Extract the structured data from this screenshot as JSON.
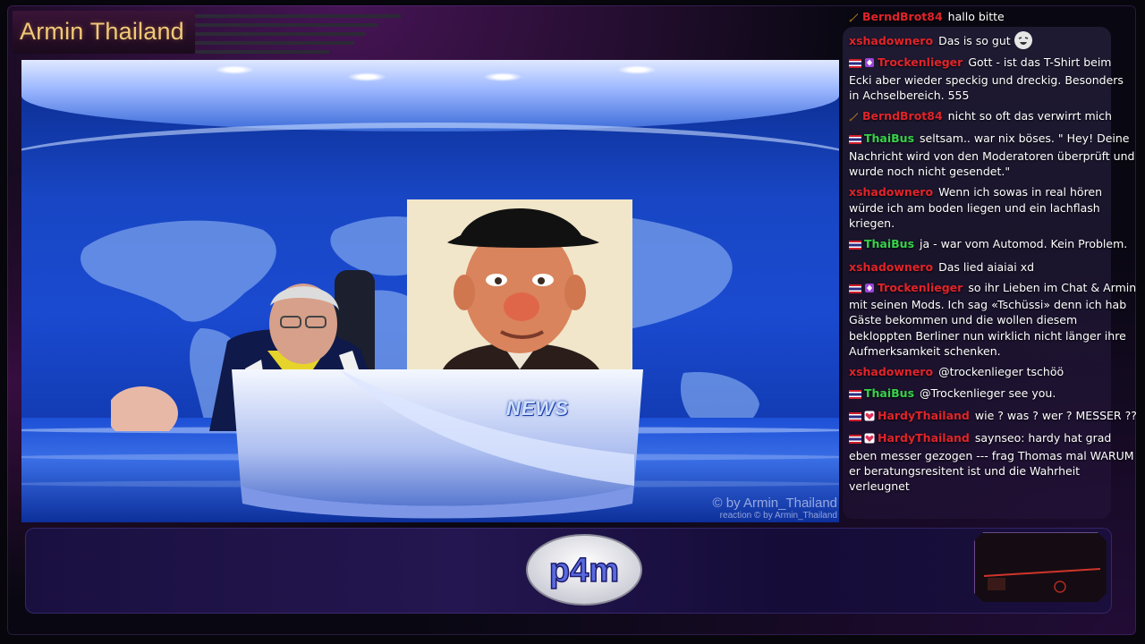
{
  "channel": {
    "title": "Armin Thailand"
  },
  "video": {
    "desk_label": "NEWS",
    "watermark_line1": "© by Armin_Thailand",
    "watermark_line2": "reaction  © by Armin_Thailand"
  },
  "logo": {
    "text": "p4m"
  },
  "chat": {
    "messages": [
      {
        "user": "BerndBrot84",
        "text": "hallo bitte",
        "user_color": "#e0242a",
        "badges": [
          "sword-icon"
        ]
      },
      {
        "user": "xshadownero",
        "text": "Das is so gut",
        "user_color": "#e0242a",
        "badges": [],
        "emote": "laughing-face-emote"
      },
      {
        "user": "Trockenlieger",
        "text": "Gott - ist das T-Shirt beim Ecki aber wieder speckig und dreckig. Besonders in Achselbereich. 555",
        "user_color": "#e0242a",
        "badges": [
          "thai-flag-icon",
          "purple-gem-icon"
        ]
      },
      {
        "user": "BerndBrot84",
        "text": "nicht so oft das verwirrt mich",
        "user_color": "#e0242a",
        "badges": [
          "sword-icon"
        ]
      },
      {
        "user": "ThaiBus",
        "text": "seltsam.. war nix böses. \" Hey! Deine Nachricht wird von den Moderatoren überprüft und wurde noch nicht gesendet.\"",
        "user_color": "#38d24a",
        "badges": [
          "thai-flag-icon"
        ]
      },
      {
        "user": "xshadownero",
        "text": "Wenn ich sowas in real hören würde ich am boden liegen und ein lachflash kriegen.",
        "user_color": "#e0242a",
        "badges": []
      },
      {
        "user": "ThaiBus",
        "text": "ja - war vom Automod. Kein Problem.",
        "user_color": "#38d24a",
        "badges": [
          "thai-flag-icon"
        ]
      },
      {
        "user": "xshadownero",
        "text": "Das lied aiaiai xd",
        "user_color": "#e0242a",
        "badges": []
      },
      {
        "user": "Trockenlieger",
        "text": "so ihr Lieben im Chat & Armin mit seinen Mods. Ich sag «Tschüssi» denn ich hab Gäste bekommen und die wollen diesem bekloppten Berliner nun wirklich nicht länger ihre Aufmerksamkeit schenken.",
        "user_color": "#e0242a",
        "badges": [
          "thai-flag-icon",
          "purple-gem-icon"
        ]
      },
      {
        "user": "xshadownero",
        "text": "@trockenlieger tschöö",
        "user_color": "#e0242a",
        "badges": []
      },
      {
        "user": "ThaiBus",
        "text": "@Trockenlieger see you.",
        "user_color": "#38d24a",
        "badges": [
          "thai-flag-icon"
        ]
      },
      {
        "user": "HardyThailand",
        "text": "wie ? was ? wer ? MESSER ??",
        "user_color": "#e0242a",
        "badges": [
          "thai-flag-icon",
          "heart-icon"
        ]
      },
      {
        "user": "HardyThailand",
        "text": "saynseo: hardy hat grad eben messer gezogen --- frag Thomas mal WARUM er beratungsresitent ist und die Wahrheit verleugnet",
        "user_color": "#e0242a",
        "badges": [
          "thai-flag-icon",
          "heart-icon"
        ]
      }
    ]
  },
  "colors": {
    "title": "#f2c878",
    "studio_blue": "#1a4ad0",
    "chat_red": "#e0242a",
    "chat_green": "#38d24a"
  }
}
